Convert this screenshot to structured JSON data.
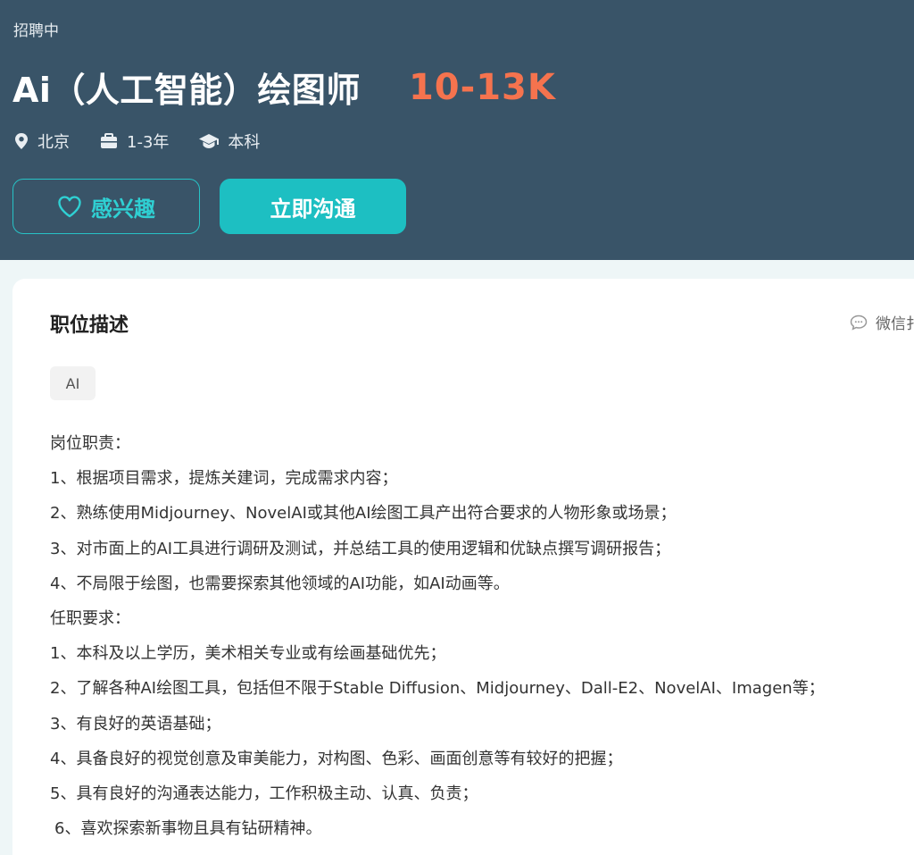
{
  "header": {
    "status": "招聘中",
    "title": "Ai（人工智能）绘图师",
    "salary": "10-13K",
    "location": "北京",
    "experience": "1-3年",
    "education": "本科",
    "interest_label": "感兴趣",
    "chat_label": "立即沟通",
    "icons": {
      "location": "location-pin-icon",
      "experience": "briefcase-icon",
      "education": "graduation-cap-icon",
      "interest": "heart-icon"
    },
    "colors": {
      "background": "#395468",
      "salary": "#f5734e",
      "accent": "#1dbfc2"
    }
  },
  "card": {
    "title": "职位描述",
    "share_label": "微信扌",
    "share_icon": "chat-bubble-icon",
    "tag": "AI",
    "lines": [
      "岗位职责：",
      "1、根据项目需求，提炼关建词，完成需求内容；",
      "2、熟练使用Midjourney、NovelAI或其他AI绘图工具产出符合要求的人物形象或场景；",
      "3、对市面上的AI工具进行调研及测试，并总结工具的使用逻辑和优缺点撰写调研报告；",
      "4、不局限于绘图，也需要探索其他领域的AI功能，如AI动画等。",
      "任职要求：",
      "1、本科及以上学历，美术相关专业或有绘画基础优先；",
      "2、了解各种AI绘图工具，包括但不限于Stable Diffusion、Midjourney、Dall-E2、NovelAI、Imagen等；",
      "3、有良好的英语基础；",
      "4、具备良好的视觉创意及审美能力，对构图、色彩、画面创意等有较好的把握；",
      "5、具有良好的沟通表达能力，工作积极主动、认真、负责；",
      "6、喜欢探索新事物且具有钻研精神。"
    ]
  }
}
